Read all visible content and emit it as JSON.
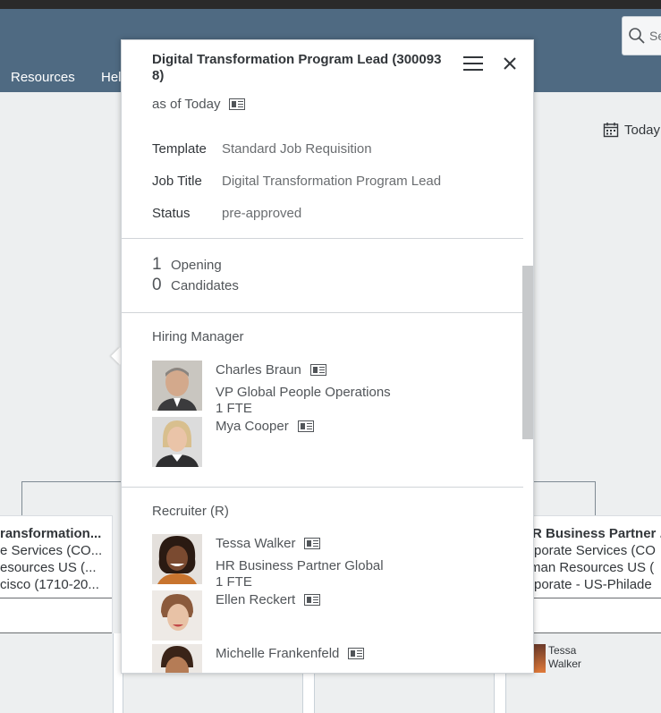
{
  "shell": {
    "search_placeholder": "Se",
    "nav": [
      "Resources",
      "Hel"
    ],
    "today_label": "Today"
  },
  "org_cards": {
    "left": [
      "ransformation...",
      "e Services (CO...",
      "esources US (...",
      "cisco (1710-20..."
    ],
    "right": [
      "R Business Partner ...",
      "rporate Services (CO",
      "man Resources US (",
      "rporate - US-Philade"
    ],
    "mini_person": {
      "first": "Tessa",
      "last": "Walker"
    }
  },
  "popover": {
    "title": "Digital Transformation Program Lead (3000938)",
    "as_of": "as of Today",
    "fields": [
      {
        "label": "Template",
        "value": "Standard Job Requisition"
      },
      {
        "label": "Job Title",
        "value": "Digital Transformation Program Lead"
      },
      {
        "label": "Status",
        "value": "pre-approved"
      }
    ],
    "counts": [
      {
        "num": "1",
        "label": "Opening"
      },
      {
        "num": "0",
        "label": "Candidates"
      }
    ],
    "hiring_manager": {
      "title": "Hiring Manager",
      "people": [
        {
          "name": "Charles Braun",
          "role": "VP Global People Operations",
          "fte": "1 FTE"
        },
        {
          "name": "Mya Cooper",
          "role": "",
          "fte": ""
        }
      ]
    },
    "recruiter": {
      "title": "Recruiter (R)",
      "people": [
        {
          "name": "Tessa Walker",
          "role": "HR Business Partner Global",
          "fte": "1 FTE"
        },
        {
          "name": "Ellen Reckert",
          "role": "",
          "fte": ""
        },
        {
          "name": "Michelle Frankenfeld",
          "role": "",
          "fte": ""
        }
      ]
    }
  },
  "colors": {
    "shellbar": "#4f6a82",
    "background": "#edeff0",
    "text": "#32363a",
    "muted": "#6a6d70"
  }
}
